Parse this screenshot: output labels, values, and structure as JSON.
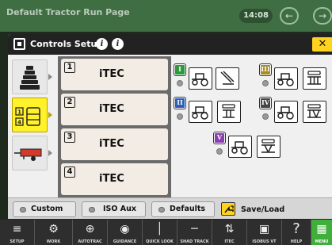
{
  "background": {
    "page_title": "Default Tractor Run Page",
    "time": "14:08"
  },
  "dialog": {
    "title": "Controls Setup",
    "slots": [
      {
        "number": "1",
        "label": "iTEC"
      },
      {
        "number": "2",
        "label": "iTEC"
      },
      {
        "number": "3",
        "label": "iTEC"
      },
      {
        "number": "4",
        "label": "iTEC"
      }
    ],
    "control_badges": [
      "I",
      "III",
      "II",
      "IV",
      "V"
    ],
    "buttons": {
      "custom": "Custom",
      "iso_aux": "ISO Aux",
      "defaults": "Defaults",
      "save_load": "Save/Load"
    }
  },
  "navbar": {
    "items": [
      "SETUP",
      "WORK",
      "AUTOTRAC",
      "GUIDANCE",
      "QUICK LOOK",
      "SHAD TRACK",
      "ITEC",
      "ISOBUS VT",
      "HELP"
    ],
    "menu": "MENU"
  },
  "colors": {
    "accent_yellow": "#ffd21f",
    "badge_green": "#2a9a3a",
    "badge_olive": "#a48c2a",
    "badge_blue": "#2b5fb8",
    "badge_dark": "#444444",
    "badge_purple": "#8a3fb0",
    "nav_green": "#3fae3a"
  }
}
